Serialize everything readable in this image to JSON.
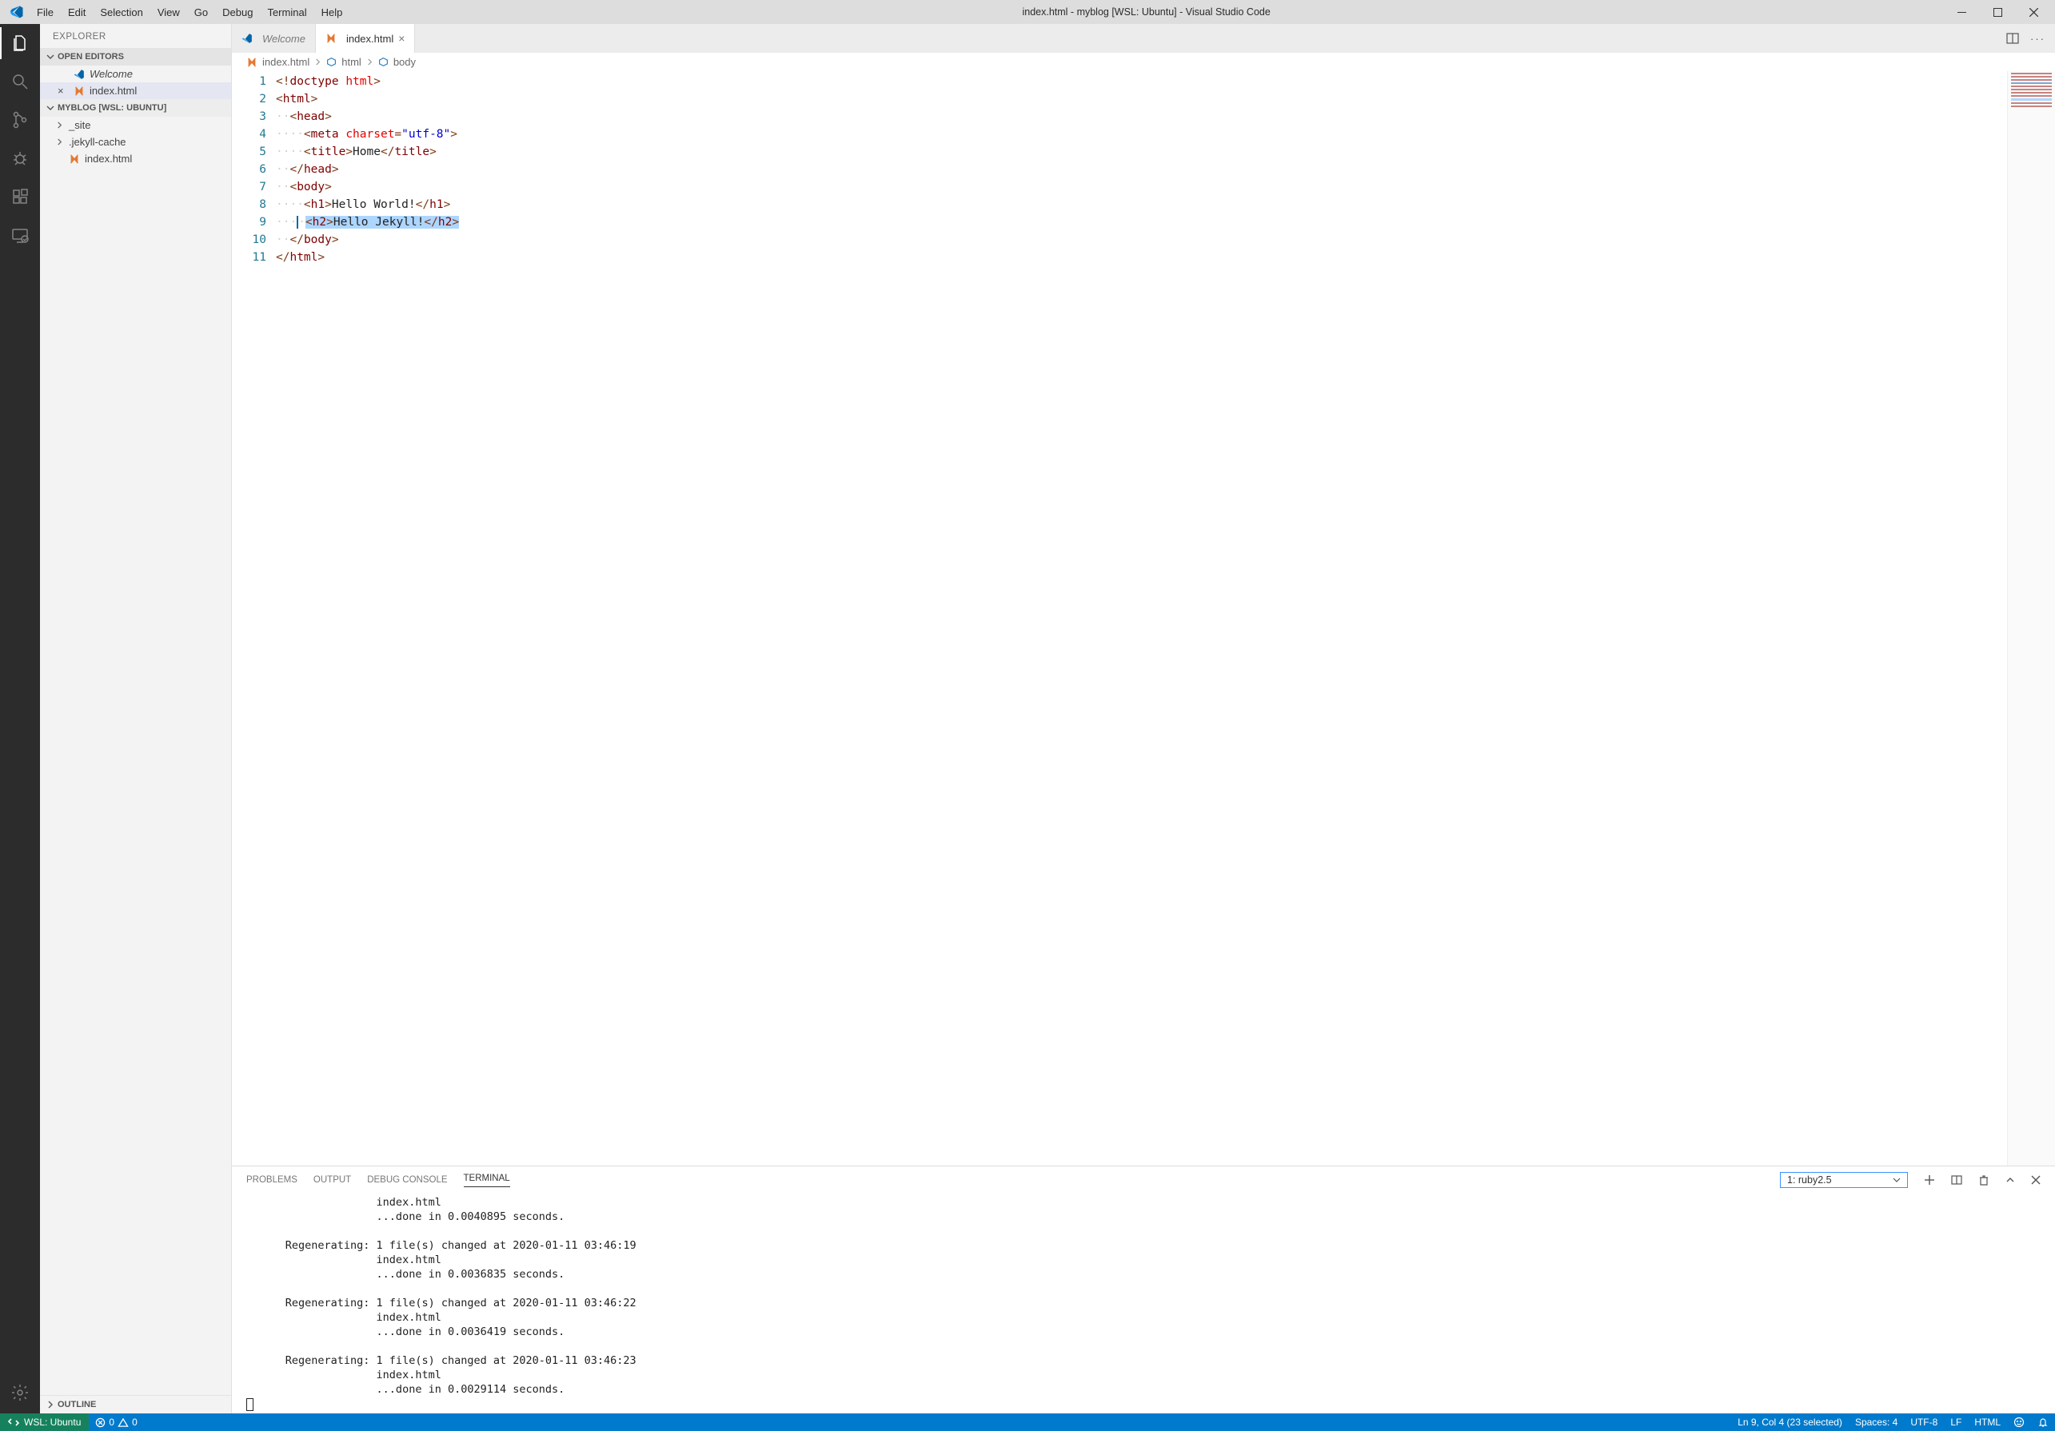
{
  "titlebar": {
    "title": "index.html - myblog [WSL: Ubuntu] - Visual Studio Code",
    "menu": [
      "File",
      "Edit",
      "Selection",
      "View",
      "Go",
      "Debug",
      "Terminal",
      "Help"
    ]
  },
  "activitybar": {
    "items": [
      "explorer-icon",
      "search-icon",
      "source-control-icon",
      "debug-icon",
      "extensions-icon",
      "remote-explorer-icon"
    ],
    "bottom": "settings-gear-icon"
  },
  "sidebar": {
    "title": "EXPLORER",
    "openEditorsLabel": "OPEN EDITORS",
    "openEditors": [
      {
        "label": "Welcome",
        "welcome": true
      },
      {
        "label": "index.html",
        "active": true
      }
    ],
    "workspaceLabel": "MYBLOG [WSL: UBUNTU]",
    "tree": [
      {
        "label": "_site",
        "kind": "folder"
      },
      {
        "label": ".jekyll-cache",
        "kind": "folder"
      },
      {
        "label": "index.html",
        "kind": "file"
      }
    ],
    "outlineLabel": "OUTLINE"
  },
  "tabs": [
    {
      "label": "Welcome",
      "active": false,
      "welcome": true
    },
    {
      "label": "index.html",
      "active": true
    }
  ],
  "breadcrumb": [
    {
      "label": "index.html",
      "icon": "file"
    },
    {
      "label": "html",
      "icon": "symbol"
    },
    {
      "label": "body",
      "icon": "symbol"
    }
  ],
  "code": {
    "lines": 11,
    "raw": [
      {
        "n": 1,
        "seg": [
          [
            "punc",
            "<!"
          ],
          [
            "tag",
            "doctype "
          ],
          [
            "attr",
            "html"
          ],
          [
            "punc",
            ">"
          ]
        ]
      },
      {
        "n": 2,
        "seg": [
          [
            "punc",
            "<"
          ],
          [
            "tag",
            "html"
          ],
          [
            "punc",
            ">"
          ]
        ]
      },
      {
        "n": 3,
        "ws": "··",
        "seg": [
          [
            "punc",
            "<"
          ],
          [
            "tag",
            "head"
          ],
          [
            "punc",
            ">"
          ]
        ]
      },
      {
        "n": 4,
        "ws": "····",
        "seg": [
          [
            "punc",
            "<"
          ],
          [
            "tag",
            "meta "
          ],
          [
            "attr",
            "charset"
          ],
          [
            "punc",
            "="
          ],
          [
            "str",
            "\"utf-8\""
          ],
          [
            "punc",
            ">"
          ]
        ]
      },
      {
        "n": 5,
        "ws": "····",
        "seg": [
          [
            "punc",
            "<"
          ],
          [
            "tag",
            "title"
          ],
          [
            "punc",
            ">"
          ],
          [
            "text",
            "Home"
          ],
          [
            "punc",
            "</"
          ],
          [
            "tag",
            "title"
          ],
          [
            "punc",
            ">"
          ]
        ]
      },
      {
        "n": 6,
        "ws": "··",
        "seg": [
          [
            "punc",
            "</"
          ],
          [
            "tag",
            "head"
          ],
          [
            "punc",
            ">"
          ]
        ]
      },
      {
        "n": 7,
        "ws": "··",
        "seg": [
          [
            "punc",
            "<"
          ],
          [
            "tag",
            "body"
          ],
          [
            "punc",
            ">"
          ]
        ]
      },
      {
        "n": 8,
        "ws": "····",
        "seg": [
          [
            "punc",
            "<"
          ],
          [
            "tag",
            "h1"
          ],
          [
            "punc",
            ">"
          ],
          [
            "text",
            "Hello World!"
          ],
          [
            "punc",
            "</"
          ],
          [
            "tag",
            "h1"
          ],
          [
            "punc",
            ">"
          ]
        ]
      },
      {
        "n": 9,
        "ws": "····",
        "selected": true,
        "seg": [
          [
            "punc",
            "<"
          ],
          [
            "tag",
            "h2"
          ],
          [
            "punc",
            ">"
          ],
          [
            "text",
            "Hello Jekyll!"
          ],
          [
            "punc",
            "</"
          ],
          [
            "tag",
            "h2"
          ],
          [
            "punc",
            ">"
          ]
        ]
      },
      {
        "n": 10,
        "ws": "··",
        "seg": [
          [
            "punc",
            "</"
          ],
          [
            "tag",
            "body"
          ],
          [
            "punc",
            ">"
          ]
        ]
      },
      {
        "n": 11,
        "seg": [
          [
            "punc",
            "</"
          ],
          [
            "tag",
            "html"
          ],
          [
            "punc",
            ">"
          ]
        ]
      }
    ]
  },
  "panel": {
    "tabs": [
      "PROBLEMS",
      "OUTPUT",
      "DEBUG CONSOLE",
      "TERMINAL"
    ],
    "activeTab": "TERMINAL",
    "dropdown": "1: ruby2.5",
    "terminalText": "                    index.html\n                    ...done in 0.0040895 seconds.\n\n      Regenerating: 1 file(s) changed at 2020-01-11 03:46:19\n                    index.html\n                    ...done in 0.0036835 seconds.\n\n      Regenerating: 1 file(s) changed at 2020-01-11 03:46:22\n                    index.html\n                    ...done in 0.0036419 seconds.\n\n      Regenerating: 1 file(s) changed at 2020-01-11 03:46:23\n                    index.html\n                    ...done in 0.0029114 seconds.\n"
  },
  "status": {
    "remote": "WSL: Ubuntu",
    "errors": "0",
    "warnings": "0",
    "cursor": "Ln 9, Col 4 (23 selected)",
    "spaces": "Spaces: 4",
    "encoding": "UTF-8",
    "eol": "LF",
    "lang": "HTML"
  }
}
